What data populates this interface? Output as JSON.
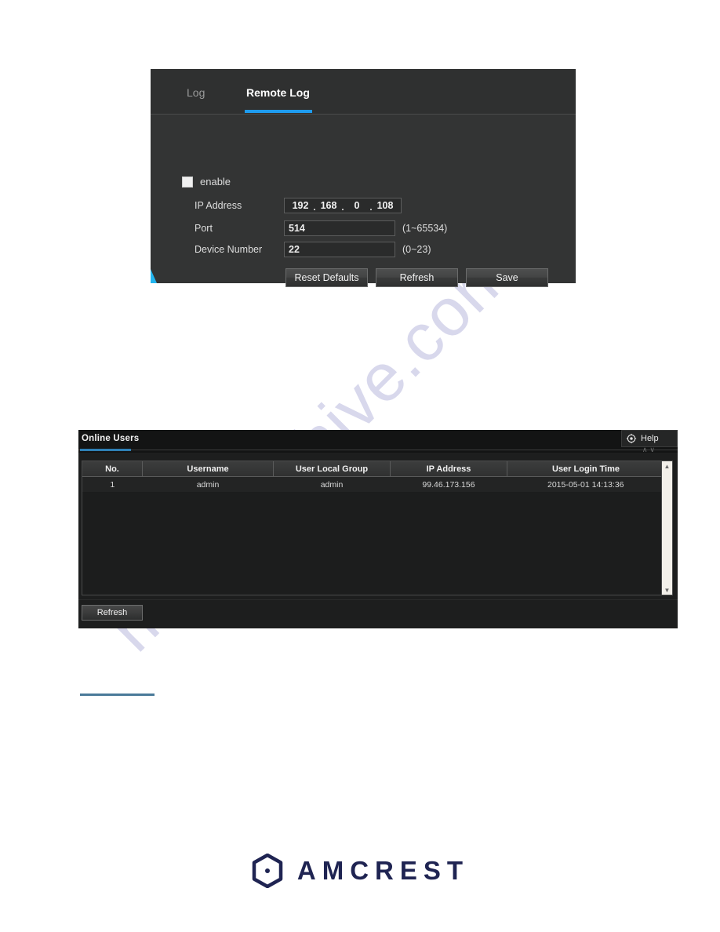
{
  "watermark": {
    "text": "manualshive.com"
  },
  "remote_log_panel": {
    "tabs": [
      {
        "label": "Log",
        "active": false
      },
      {
        "label": "Remote Log",
        "active": true
      }
    ],
    "enable_checkbox": {
      "label": "enable",
      "checked": false
    },
    "fields": [
      {
        "label": "IP Address",
        "type": "ip",
        "octets": [
          "192",
          "168",
          "0",
          "108"
        ],
        "separator": ".",
        "hint": ""
      },
      {
        "label": "Port",
        "type": "text",
        "value": "514",
        "hint": "(1~65534)"
      },
      {
        "label": "Device Number",
        "type": "text",
        "value": "22",
        "hint": "(0~23)"
      }
    ],
    "buttons": [
      {
        "label": "Reset Defaults"
      },
      {
        "label": "Refresh"
      },
      {
        "label": "Save"
      }
    ],
    "accent_color": "#1e9bee"
  },
  "online_users_panel": {
    "title": "Online Users",
    "help": {
      "label": "Help",
      "icon": "help-compass-icon"
    },
    "table": {
      "columns": [
        "No.",
        "Username",
        "User Local Group",
        "IP Address",
        "User Login Time"
      ],
      "rows": [
        [
          "1",
          "admin",
          "admin",
          "99.46.173.156",
          "2015-05-01 14:13:36"
        ]
      ]
    },
    "refresh_button": {
      "label": "Refresh"
    },
    "title_underline_color": "#2e7fb5"
  },
  "footer": {
    "brand": "AMCREST",
    "brand_color": "#1f2452"
  }
}
